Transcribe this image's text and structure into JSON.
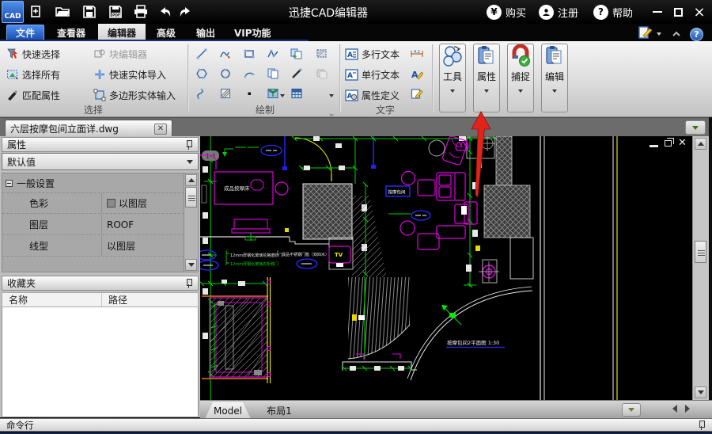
{
  "window": {
    "title": "迅捷CAD编辑器"
  },
  "titlebar": {
    "buy": "购买",
    "register": "注册",
    "help": "帮助"
  },
  "menubar": {
    "items": [
      "文件",
      "查看器",
      "编辑器",
      "高级",
      "输出",
      "VIP功能"
    ],
    "active": "编辑器"
  },
  "ribbon": {
    "select_group": {
      "label": "选择",
      "items": [
        "快速选择",
        "选择所有",
        "匹配属性",
        "块编辑器",
        "快速实体导入",
        "多边形实体输入"
      ]
    },
    "draw_group": {
      "label": "绘制"
    },
    "text_group": {
      "label": "文字",
      "items": [
        "多行文本",
        "单行文本",
        "属性定义"
      ]
    },
    "big_buttons": [
      "工具",
      "属性",
      "捕捉",
      "编辑"
    ]
  },
  "doc_tabs": {
    "active": "六层按摩包间立面详.dwg"
  },
  "properties_panel": {
    "title": "属性",
    "preset": "默认值",
    "section": "一般设置",
    "rows": [
      {
        "name": "色彩",
        "value": "以图层"
      },
      {
        "name": "图层",
        "value": "ROOF"
      },
      {
        "name": "线型",
        "value": "以图层"
      }
    ]
  },
  "favorites_panel": {
    "title": "收藏夹",
    "columns": [
      "名称",
      "路径"
    ]
  },
  "layout_bar": {
    "tabs": [
      "Model",
      "布局1"
    ]
  },
  "command_bar": {
    "title": "命令行"
  },
  "canvas": {
    "plan_title": "按摩包间2平面图 1:30",
    "bed_label": "成品按摩床",
    "room_label": "按摩包间",
    "tv_label": "TV",
    "ref_label": "1-1",
    "note_door": "12mm厚钢化玻璃花格磨砂门",
    "note_wardrobe": "12mm厚钢化玻璃衣柜移门",
    "note_threshold": "成品不锈钢门槛（双四水）"
  },
  "colors": {
    "accent_blue": "#2f6fd6",
    "cad_green": "#00d200",
    "cad_magenta": "#e000e0",
    "cad_yellow": "#f0f000",
    "cad_blue": "#2a2aff",
    "arrow_red": "#e0241b"
  }
}
